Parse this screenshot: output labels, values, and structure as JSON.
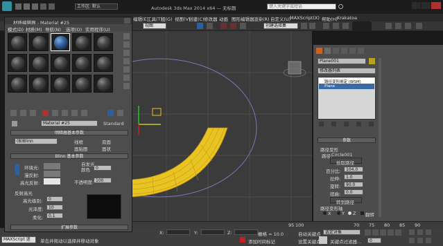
{
  "app": {
    "title": "Autodesk 3ds Max 2014 x64 — 无标题",
    "workspace": "工作区: 默认",
    "search_placeholder": "键入关键字或短语"
  },
  "menu": [
    "编辑(E)",
    "工具(T)",
    "组(G)",
    "视图(V)",
    "创建(C)",
    "修改器",
    "动画",
    "图形编辑器",
    "渲染(R)",
    "自定义(U)",
    "MAXScript(X)",
    "帮助(H)",
    "Krakatoa"
  ],
  "toolbar": {
    "view_dropdown": "视图",
    "selection_set": "创建选择集"
  },
  "material_editor": {
    "title": "材质编辑器 - Material #25",
    "menu": [
      "模式(D)",
      "材质(M)",
      "导航(N)",
      "选项(O)",
      "实用程序(U)"
    ],
    "material_name": "Material #25",
    "material_type": "Standard",
    "shader_rollout": "明暗器基本参数",
    "shader": "(B)Blinn",
    "checkboxes": [
      "线框",
      "双面",
      "面贴图",
      "面状"
    ],
    "blinn_rollout": "Blinn 基本参数",
    "self_illum_title": "自发光",
    "color_label": "颜色",
    "self_illum_value": "0",
    "ambient": "环境光:",
    "diffuse": "漫反射:",
    "specular": "高光反射:",
    "opacity_label": "不透明度:",
    "opacity_value": "100",
    "specular_highlights": "反射高光",
    "spec_level_label": "高光级别:",
    "spec_level": "0",
    "glossiness_label": "光泽度:",
    "glossiness": "10",
    "soften_label": "柔化:",
    "soften": "0.1",
    "expand_rollout": "扩展参数"
  },
  "command_panel": {
    "object_name": "Plane001",
    "modifier_list": "修改器列表",
    "stack": [
      "路径变形绑定 (WSM)",
      "Plane"
    ],
    "params_title": "参数",
    "path_deform": "路径变形",
    "path_label": "路径:",
    "path_value": "Circle001",
    "pick_path": "拾取路径",
    "percent_label": "百分比:",
    "percent": "104.0",
    "stretch_label": "拉伸:",
    "stretch": "1.0",
    "rotation_label": "旋转:",
    "rotation": "90.0",
    "twist_label": "扭曲:",
    "twist": "0.0",
    "move_to_path": "转到路径",
    "axis_title": "路径变形轴",
    "axis_x": "X",
    "axis_y": "Y",
    "axis_z": "Z",
    "flip": "翻转"
  },
  "timeline": {
    "ticks": [
      "0",
      "70",
      "75",
      "80",
      "85",
      "90",
      "95",
      "100"
    ]
  },
  "status": {
    "maxscript": "MAXScript 迷",
    "prompt": "单击并拖动以选择并移动对象",
    "x_label": "X:",
    "y_label": "Y:",
    "z_label": "Z:",
    "grid": "栅格 = 10.0",
    "add_time_tag": "添加时间标记",
    "auto_key": "自动关键点",
    "set_key": "设置关键点",
    "selected": "选定对象",
    "key_filters": "关键点过滤器...",
    "frame": "0"
  },
  "colors": {
    "accent_orange": "#e08c1a",
    "mesh_yellow": "#e8c422",
    "viewport_bg": "#3b3b3b"
  }
}
